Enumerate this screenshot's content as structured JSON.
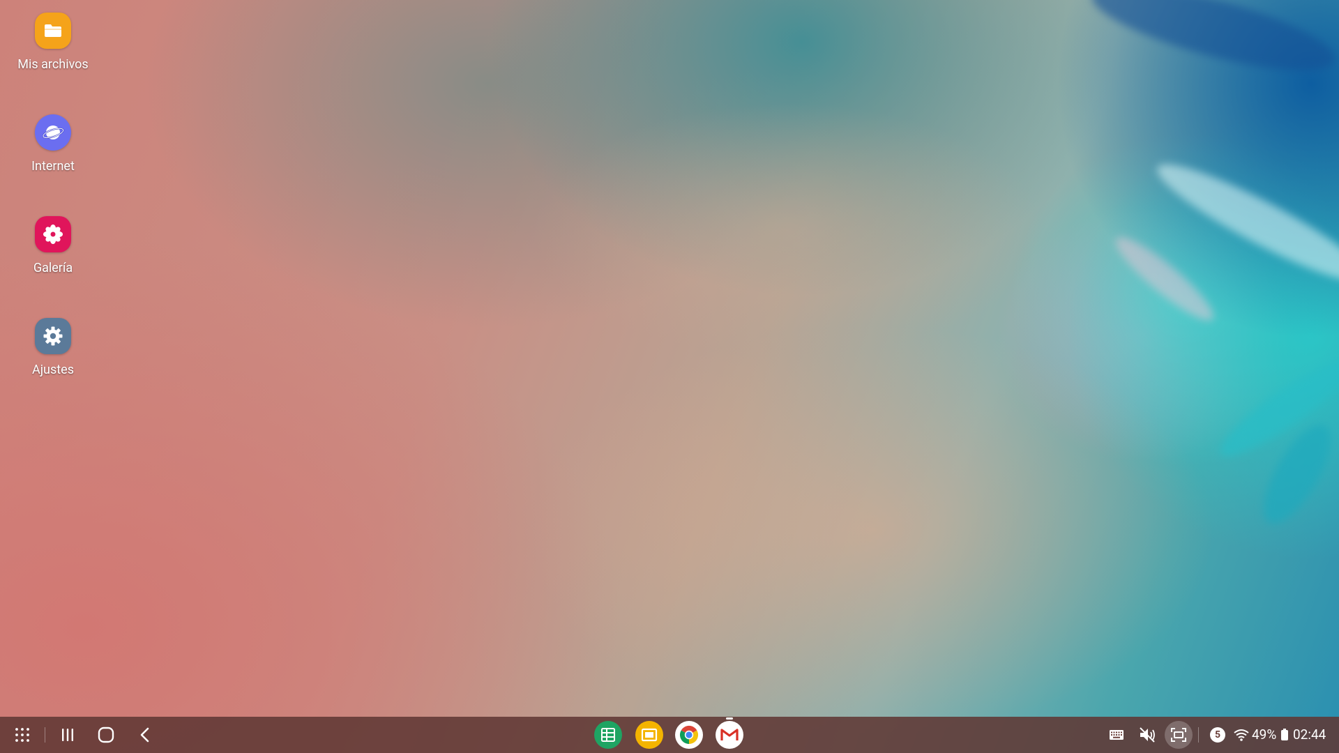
{
  "desktop": {
    "icons": [
      {
        "name": "my-files",
        "label": "Mis archivos",
        "icon": "folder-icon",
        "color": "#f5a31a"
      },
      {
        "name": "internet",
        "label": "Internet",
        "icon": "planet-icon",
        "color": "#6b6ef0"
      },
      {
        "name": "gallery",
        "label": "Galería",
        "icon": "flower-icon",
        "color": "#e0155b"
      },
      {
        "name": "settings",
        "label": "Ajustes",
        "icon": "gear-icon",
        "color": "#5b7a99"
      }
    ]
  },
  "taskbar": {
    "nav": [
      "apps-grid-icon",
      "recents-icon",
      "home-icon",
      "back-icon"
    ],
    "apps": [
      {
        "name": "google-sheets",
        "icon": "sheets-icon",
        "color": "#1fa463"
      },
      {
        "name": "google-slides",
        "icon": "slides-icon",
        "color": "#f4b400"
      },
      {
        "name": "chrome",
        "icon": "chrome-icon",
        "color": "#ffffff"
      },
      {
        "name": "gmail",
        "icon": "gmail-icon",
        "color": "#ffffff"
      }
    ],
    "status": {
      "notification_count": "5",
      "battery": "49%",
      "time": "02:44"
    }
  }
}
